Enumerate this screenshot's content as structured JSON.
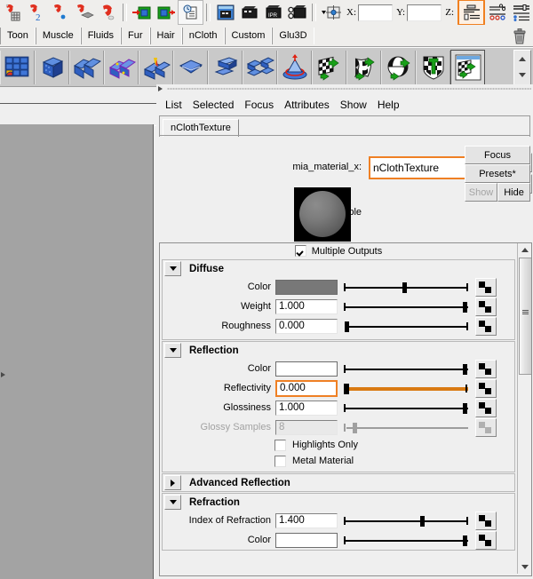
{
  "toolbar1": {
    "buttons": [
      {
        "name": "magnet-grid-icon",
        "label": "Snap to grids"
      },
      {
        "name": "magnet-curve-icon",
        "label": "Snap to curves"
      },
      {
        "name": "magnet-point-icon",
        "label": "Snap to points"
      },
      {
        "name": "magnet-projected-center-icon",
        "label": "Snap to projected center"
      },
      {
        "name": "magnet-plane-icon",
        "label": "Snap to view planes"
      },
      {
        "name": "make-live-in-icon",
        "label": "Make the selected object live"
      },
      {
        "name": "make-live-out-icon",
        "label": "Make the selected object live out"
      },
      {
        "name": "history-icon",
        "label": "Construction history"
      },
      {
        "name": "render-current-frame-icon",
        "label": "Render the current frame"
      },
      {
        "name": "render-sequence-icon",
        "label": "Open render view"
      },
      {
        "name": "ipr-render-icon",
        "label": "IPR render current frame"
      },
      {
        "name": "render-settings-icon",
        "label": "Display render settings"
      }
    ],
    "coord_dropdown": "coordinate-input-mode-icon",
    "x_label": "X:",
    "y_label": "Y:",
    "z_label": "Z:",
    "x_value": "",
    "y_value": "",
    "z_value": "",
    "right_buttons": [
      {
        "name": "attribute-editor-icon",
        "label": "Show or hide the Attribute Editor",
        "highlighted": true
      },
      {
        "name": "tool-settings-icon",
        "label": "Show or hide the Tool Settings",
        "highlighted": false
      },
      {
        "name": "channel-box-icon",
        "label": "Show or hide the Channel Box",
        "highlighted": false
      }
    ]
  },
  "shelf_tabs": [
    {
      "label": "Toon"
    },
    {
      "label": "Muscle"
    },
    {
      "label": "Fluids"
    },
    {
      "label": "Fur"
    },
    {
      "label": "Hair"
    },
    {
      "label": "nCloth"
    },
    {
      "label": "Custom"
    },
    {
      "label": "Glu3D"
    }
  ],
  "shelf_trash": "trash-can-icon",
  "shelf_icons": [
    {
      "name": "create-ncloth-icon"
    },
    {
      "name": "create-passive-collider-icon"
    },
    {
      "name": "remove-ncloth-icon"
    },
    {
      "name": "display-current-mesh-icon"
    },
    {
      "name": "display-input-mesh-icon"
    },
    {
      "name": "create-ncloth-constraint-icon"
    },
    {
      "name": "transform-constraint-icon"
    },
    {
      "name": "component-to-component-icon"
    },
    {
      "name": "point-to-surface-icon"
    },
    {
      "name": "ncloth-texture-checker-icon"
    },
    {
      "name": "ncloth-cache-checker-icon"
    },
    {
      "name": "ncloth-sphere-checker-icon"
    },
    {
      "name": "ncloth-shield-checker-icon"
    },
    {
      "name": "ncloth-window-checker-icon",
      "selected": true
    }
  ],
  "shelf_scroll": {
    "up": "scroll-up-icon",
    "down": "scroll-down-icon"
  },
  "editor": {
    "menu": [
      "List",
      "Selected",
      "Focus",
      "Attributes",
      "Show",
      "Help"
    ],
    "node_tab": "nClothTexture",
    "material_type_label": "mia_material_x:",
    "node_name": "nClothTexture",
    "io_buttons": [
      {
        "name": "input-connection-icon"
      },
      {
        "name": "output-connection-icon"
      }
    ],
    "side_buttons": [
      {
        "name": "focus-button",
        "label": "Focus",
        "disabled": false
      },
      {
        "name": "presets-button",
        "label": "Presets*",
        "disabled": false
      },
      {
        "name": "show-button",
        "label": "Show",
        "disabled": true
      },
      {
        "name": "hide-button",
        "label": "Hide",
        "disabled": false
      }
    ],
    "sample_label": "Sample",
    "multiple_outputs": {
      "label": "Multiple Outputs",
      "checked": true
    },
    "sections": [
      {
        "name": "diffuse",
        "title": "Diffuse",
        "expanded": true,
        "rows": [
          {
            "type": "color",
            "label": "Color",
            "swatch": "#787878",
            "slider": 0.5,
            "mapped": true
          },
          {
            "type": "value",
            "label": "Weight",
            "value": "1.000",
            "slider": 1.0,
            "mapped": true
          },
          {
            "type": "value",
            "label": "Roughness",
            "value": "0.000",
            "slider": 0.0,
            "mapped": true
          }
        ]
      },
      {
        "name": "reflection",
        "title": "Reflection",
        "expanded": true,
        "rows": [
          {
            "type": "color",
            "label": "Color",
            "swatch": "#ffffff",
            "slider": 1.0,
            "mapped": true
          },
          {
            "type": "value",
            "label": "Reflectivity",
            "value": "0.000",
            "slider": 0.0,
            "mapped": true,
            "highlighted": true,
            "orange_track": true
          },
          {
            "type": "value",
            "label": "Glossiness",
            "value": "1.000",
            "slider": 1.0,
            "mapped": true
          },
          {
            "type": "value",
            "label": "Glossy Samples",
            "value": "8",
            "slider": 0.06,
            "mapped": true,
            "disabled": true
          }
        ],
        "checkboxes": [
          {
            "label": "Highlights Only",
            "checked": false
          },
          {
            "label": "Metal Material",
            "checked": false
          }
        ]
      },
      {
        "name": "advanced-reflection",
        "title": "Advanced Reflection",
        "expanded": false,
        "rows": []
      },
      {
        "name": "refraction",
        "title": "Refraction",
        "expanded": true,
        "rows": [
          {
            "type": "value",
            "label": "Index of Refraction",
            "value": "1.400",
            "slider": 0.62,
            "mapped": true
          },
          {
            "type": "color",
            "label": "Color",
            "swatch": "#ffffff",
            "slider": 1.0,
            "mapped": true
          }
        ]
      }
    ],
    "scrollbar": {
      "up": "scroll-up-icon",
      "down": "scroll-down-icon",
      "thumb": "scroll-thumb"
    }
  },
  "colors": {
    "accent_orange": "#ef8024",
    "slider_orange": "#d97a12",
    "panel_bg": "#efefef",
    "viewport_bg": "#a3a3a3"
  }
}
